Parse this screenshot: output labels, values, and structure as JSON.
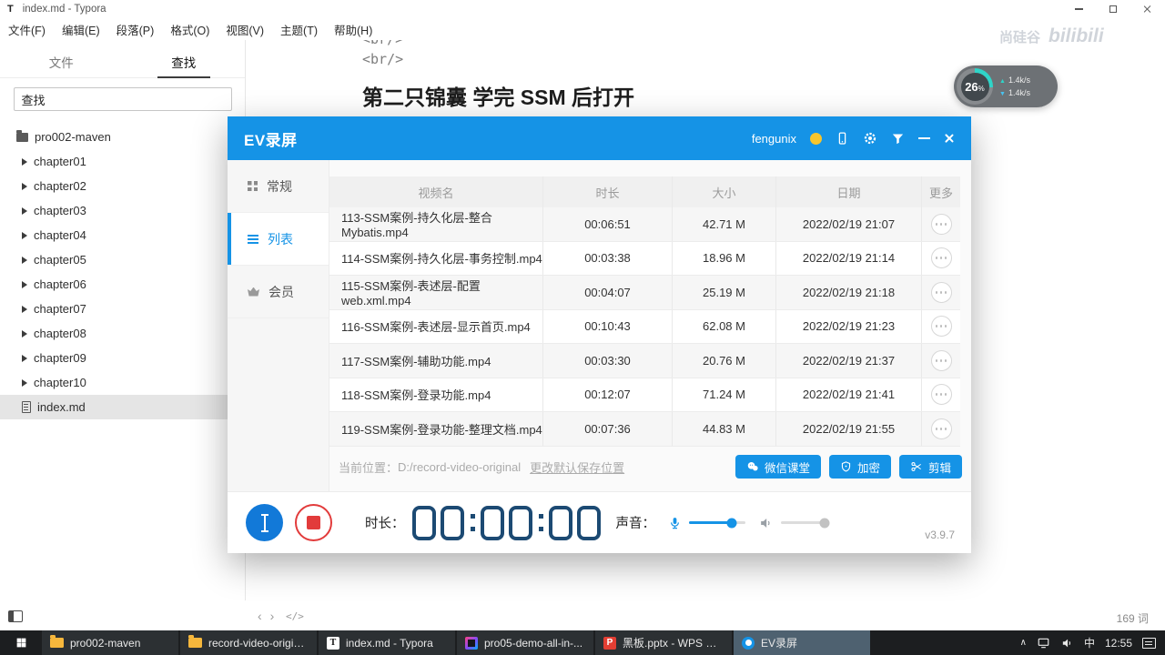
{
  "typora": {
    "window_title": "index.md - Typora",
    "logo_letter": "T",
    "menu": [
      "文件(F)",
      "编辑(E)",
      "段落(P)",
      "格式(O)",
      "视图(V)",
      "主题(T)",
      "帮助(H)"
    ],
    "sidebar": {
      "tabs": [
        "文件",
        "查找"
      ],
      "search_value": "查找",
      "tree": [
        {
          "label": "pro002-maven"
        },
        {
          "label": "chapter01"
        },
        {
          "label": "chapter02"
        },
        {
          "label": "chapter03"
        },
        {
          "label": "chapter04"
        },
        {
          "label": "chapter05"
        },
        {
          "label": "chapter06"
        },
        {
          "label": "chapter07"
        },
        {
          "label": "chapter08"
        },
        {
          "label": "chapter09"
        },
        {
          "label": "chapter10"
        },
        {
          "label": "index.md"
        }
      ]
    },
    "document": {
      "code_line_1": "<br/>",
      "code_line_2": "<br/>",
      "heading": "第二只锦囊 学完 SSM 后打开"
    },
    "statusbar": {
      "back_icon": "‹",
      "forward_icon": "›",
      "source_icon": "</>",
      "word_count": "169 词"
    }
  },
  "ev": {
    "title": "EV录屏",
    "username": "fengunix",
    "nav": [
      {
        "label": "常规"
      },
      {
        "label": "列表"
      },
      {
        "label": "会员"
      }
    ],
    "table": {
      "headers": [
        "视频名",
        "时长",
        "大小",
        "日期",
        "更多"
      ],
      "rows": [
        {
          "name": "113-SSM案例-持久化层-整合Mybatis.mp4",
          "duration": "00:06:51",
          "size": "42.71 M",
          "date": "2022/02/19 21:07"
        },
        {
          "name": "114-SSM案例-持久化层-事务控制.mp4",
          "duration": "00:03:38",
          "size": "18.96 M",
          "date": "2022/02/19 21:14"
        },
        {
          "name": "115-SSM案例-表述层-配置 web.xml.mp4",
          "duration": "00:04:07",
          "size": "25.19 M",
          "date": "2022/02/19 21:18"
        },
        {
          "name": "116-SSM案例-表述层-显示首页.mp4",
          "duration": "00:10:43",
          "size": "62.08 M",
          "date": "2022/02/19 21:23"
        },
        {
          "name": "117-SSM案例-辅助功能.mp4",
          "duration": "00:03:30",
          "size": "20.76 M",
          "date": "2022/02/19 21:37"
        },
        {
          "name": "118-SSM案例-登录功能.mp4",
          "duration": "00:12:07",
          "size": "71.24 M",
          "date": "2022/02/19 21:41"
        },
        {
          "name": "119-SSM案例-登录功能-整理文档.mp4",
          "duration": "00:07:36",
          "size": "44.83 M",
          "date": "2022/02/19 21:55"
        }
      ]
    },
    "footer": {
      "location_label": "当前位置：",
      "location_path": "D:/record-video-original",
      "change_link": "更改默认保存位置",
      "wechat_button": "微信课堂",
      "encrypt_button": "加密",
      "edit_button": "剪辑"
    },
    "controls": {
      "duration_label": "时长：",
      "time": "00:00:00",
      "sound_label": "声音：",
      "version": "v3.9.7"
    }
  },
  "overlay": {
    "gauge": {
      "percent": 26,
      "unit": "%",
      "upload": "1.4k/s",
      "download": "1.4k/s"
    },
    "watermark": {
      "text_cn": "尚硅谷",
      "text_en": "bilibili"
    }
  },
  "taskbar": {
    "items": [
      {
        "label": "pro002-maven"
      },
      {
        "label": "record-video-origin..."
      },
      {
        "label": "index.md - Typora",
        "letter": "T"
      },
      {
        "label": "pro05-demo-all-in-..."
      },
      {
        "label": "黑板.pptx - WPS Off...",
        "letter": "P"
      },
      {
        "label": "EV录屏"
      }
    ],
    "tray": {
      "ime": "中",
      "time": "12:55"
    }
  }
}
